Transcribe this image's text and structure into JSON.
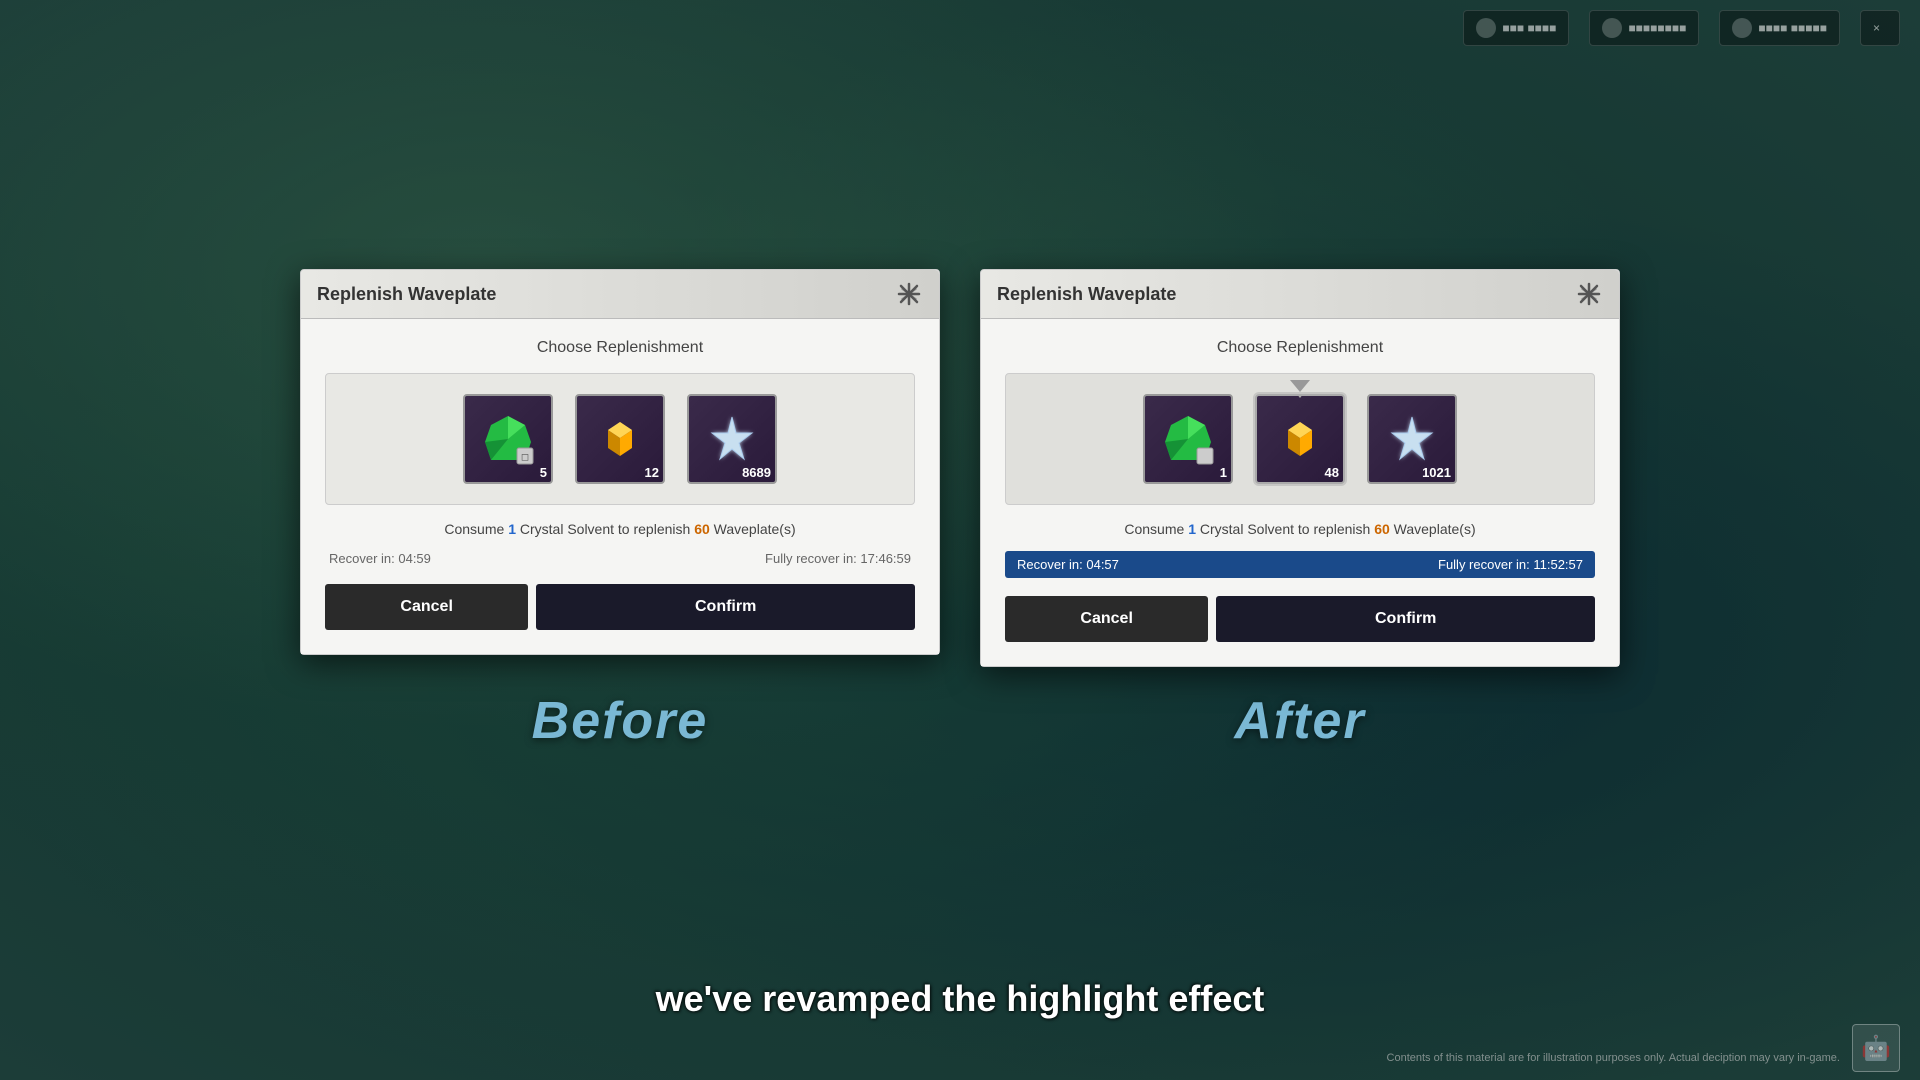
{
  "background": {
    "color": "#1c3d38"
  },
  "top_hud": {
    "items": [
      {
        "label": "■■■ ■■■■",
        "value": ""
      },
      {
        "label": "■■■■■■■■",
        "value": ""
      },
      {
        "label": "■■■■ ■■■■■",
        "value": ""
      }
    ],
    "close_icon": "×"
  },
  "before_dialog": {
    "title": "Replenish Waveplate",
    "section_label": "Choose Replenishment",
    "items": [
      {
        "id": "crystal",
        "count": "5",
        "selected": false
      },
      {
        "id": "gold_cube",
        "count": "12",
        "selected": false
      },
      {
        "id": "star",
        "count": "8689",
        "selected": false
      }
    ],
    "consume_text_prefix": "Consume ",
    "consume_num": "1",
    "consume_text_mid": " Crystal Solvent to replenish ",
    "consume_waveplate": "60",
    "consume_text_suffix": " Waveplate(s)",
    "recover_label": "Recover in: 04:59",
    "fully_recover_label": "Fully recover in: 17:46:59",
    "cancel_label": "Cancel",
    "confirm_label": "Confirm",
    "highlighted": false
  },
  "after_dialog": {
    "title": "Replenish Waveplate",
    "section_label": "Choose Replenishment",
    "items": [
      {
        "id": "crystal",
        "count": "1",
        "selected": false
      },
      {
        "id": "gold_cube",
        "count": "48",
        "selected": true
      },
      {
        "id": "star",
        "count": "1021",
        "selected": false
      }
    ],
    "consume_text_prefix": "Consume ",
    "consume_num": "1",
    "consume_text_mid": " Crystal Solvent to replenish ",
    "consume_waveplate": "60",
    "consume_text_suffix": " Waveplate(s)",
    "recover_label": "Recover in: 04:57",
    "fully_recover_label": "Fully recover in: 11:52:57",
    "cancel_label": "Cancel",
    "confirm_label": "Confirm",
    "highlighted": true
  },
  "labels": {
    "before": "Before",
    "after": "After"
  },
  "subtitle": "we've revamped the highlight effect",
  "disclaimer": "Contents of this material are for illustration purposes only. Actual deciption may vary in-game."
}
